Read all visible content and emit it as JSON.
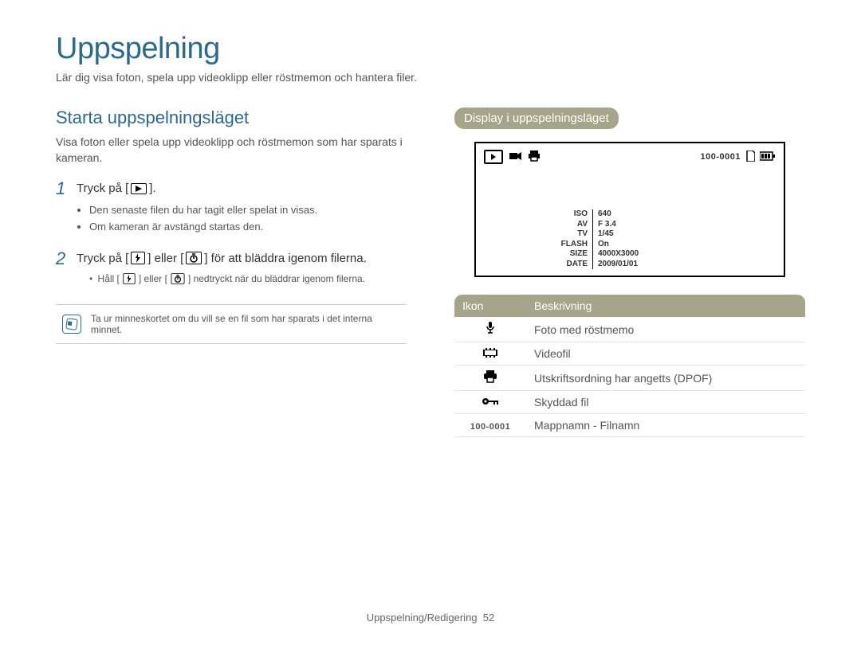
{
  "title": "Uppspelning",
  "subtitle": "Lär dig visa foton, spela upp videoklipp eller röstmemon och hantera filer.",
  "left": {
    "heading": "Starta uppspelningsläget",
    "desc": "Visa foton eller spela upp videoklipp och röstmemon som har sparats i kameran.",
    "step1": {
      "num": "1",
      "pre": "Tryck på [",
      "post": "]."
    },
    "step1_bullets": [
      "Den senaste filen du har tagit eller spelat in visas.",
      "Om kameran är avstängd startas den."
    ],
    "step2": {
      "num": "2",
      "pre": "Tryck på [",
      "mid": "] eller [",
      "post": "] för att bläddra igenom filerna."
    },
    "step2_sub": {
      "pre": "Håll [",
      "mid": "] eller [",
      "post": "] nedtryckt när du bläddrar igenom filerna."
    },
    "note": "Ta ur minneskortet om du vill se en fil som har sparats i det interna minnet."
  },
  "right": {
    "heading": "Display i uppspelningsläget",
    "screen": {
      "file_number": "100-0001",
      "meta": [
        {
          "label": "ISO",
          "value": "640"
        },
        {
          "label": "AV",
          "value": "F 3.4"
        },
        {
          "label": "TV",
          "value": "1/45"
        },
        {
          "label": "FLASH",
          "value": "On"
        },
        {
          "label": "SIZE",
          "value": "4000X3000"
        },
        {
          "label": "DATE",
          "value": "2009/01/01"
        }
      ]
    },
    "table": {
      "head": {
        "icon": "Ikon",
        "desc": "Beskrivning"
      },
      "rows": [
        {
          "icon_name": "microphone-icon",
          "glyph": "🎤",
          "desc": "Foto med röstmemo"
        },
        {
          "icon_name": "video-icon",
          "glyph": "🎬",
          "desc": "Videofil"
        },
        {
          "icon_name": "printer-icon",
          "glyph": "🖶",
          "desc": "Utskriftsordning har angetts (DPOF)"
        },
        {
          "icon_name": "lock-icon",
          "glyph": "⊶",
          "desc": "Skyddad fil"
        },
        {
          "icon_name": "folder-file-label",
          "glyph": "100-0001",
          "desc": "Mappnamn - Filnamn"
        }
      ]
    }
  },
  "footer": {
    "text": "Uppspelning/Redigering",
    "page": "52"
  }
}
